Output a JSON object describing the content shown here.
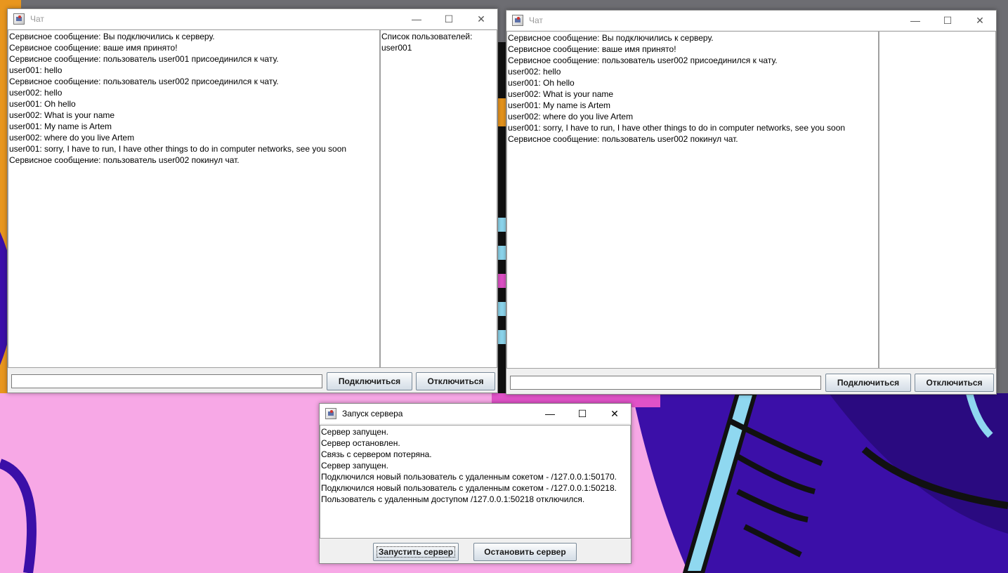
{
  "chat_window_1": {
    "title": "Чат",
    "messages": [
      "Сервисное сообщение: Вы подключились к серверу.",
      "Сервисное сообщение: ваше имя принято!",
      "Сервисное сообщение: пользователь user001 присоединился к чату.",
      "user001: hello",
      "Сервисное сообщение: пользователь user002 присоединился к чату.",
      "user002: hello",
      "user001: Oh hello",
      "user002: What is your name",
      "user001: My name is Artem",
      "user002: where do you live Artem",
      "user001: sorry, I have to run, I have other things to do in computer networks, see you soon",
      "Сервисное сообщение: пользователь user002 покинул чат."
    ],
    "users_header": "Список пользователей:",
    "users": [
      "user001"
    ],
    "input_value": "",
    "connect_label": "Подключиться",
    "disconnect_label": "Отключиться"
  },
  "chat_window_2": {
    "title": "Чат",
    "messages": [
      "Сервисное сообщение: Вы подключились к серверу.",
      "Сервисное сообщение: ваше имя принято!",
      "Сервисное сообщение: пользователь user002 присоединился к чату.",
      "user002: hello",
      "user001: Oh hello",
      "user002: What is your name",
      "user001: My name is Artem",
      "user002: where do you live Artem",
      "user001: sorry, I have to run, I have other things to do in computer networks, see you soon",
      "Сервисное сообщение: пользователь user002 покинул чат."
    ],
    "input_value": "",
    "connect_label": "Подключиться",
    "disconnect_label": "Отключиться"
  },
  "server_window": {
    "title": "Запуск сервера",
    "log": [
      "Сервер запущен.",
      "Сервер остановлен.",
      "Связь с сервером потеряна.",
      "Сервер запущен.",
      "Подключился новый пользователь с удаленным сокетом - /127.0.0.1:50170.",
      "Подключился новый пользователь с удаленным сокетом - /127.0.0.1:50218.",
      "Пользователь с удаленным доступом /127.0.0.1:50218 отключился."
    ],
    "start_label": "Запустить сервер",
    "stop_label": "Остановить сервер"
  },
  "window_controls": {
    "minimize": "—",
    "maximize": "☐",
    "close": "✕"
  },
  "colors": {
    "wallpaper_pink": "#f7a8e6",
    "wallpaper_purple": "#3b0fa8",
    "wallpaper_dark": "#1a1a1a",
    "wallpaper_cyan": "#8fd8f0",
    "wallpaper_gray": "#6d6d72"
  }
}
